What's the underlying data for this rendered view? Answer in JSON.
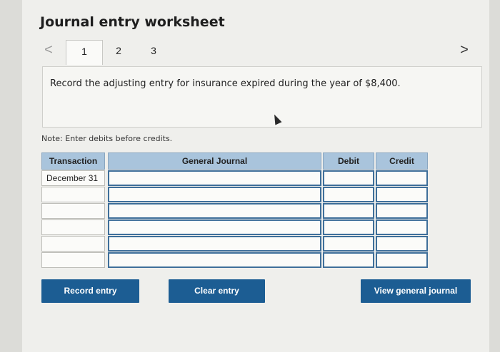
{
  "title": "Journal entry worksheet",
  "nav": {
    "prev": "<",
    "next": ">"
  },
  "tabs": [
    "1",
    "2",
    "3"
  ],
  "instruction": "Record the adjusting entry for insurance expired during the year of $8,400.",
  "note": "Note: Enter debits before credits.",
  "table": {
    "headers": {
      "transaction": "Transaction",
      "journal": "General Journal",
      "debit": "Debit",
      "credit": "Credit"
    },
    "rows": [
      {
        "transaction": "December 31",
        "account": "",
        "debit": "",
        "credit": ""
      },
      {
        "transaction": "",
        "account": "",
        "debit": "",
        "credit": ""
      },
      {
        "transaction": "",
        "account": "",
        "debit": "",
        "credit": ""
      },
      {
        "transaction": "",
        "account": "",
        "debit": "",
        "credit": ""
      },
      {
        "transaction": "",
        "account": "",
        "debit": "",
        "credit": ""
      },
      {
        "transaction": "",
        "account": "",
        "debit": "",
        "credit": ""
      }
    ]
  },
  "buttons": {
    "record": "Record entry",
    "clear": "Clear entry",
    "view": "View general journal"
  },
  "colors": {
    "header_bg": "#a9c4dc",
    "button_bg": "#1c5d93",
    "input_border": "#3f6f9a"
  }
}
